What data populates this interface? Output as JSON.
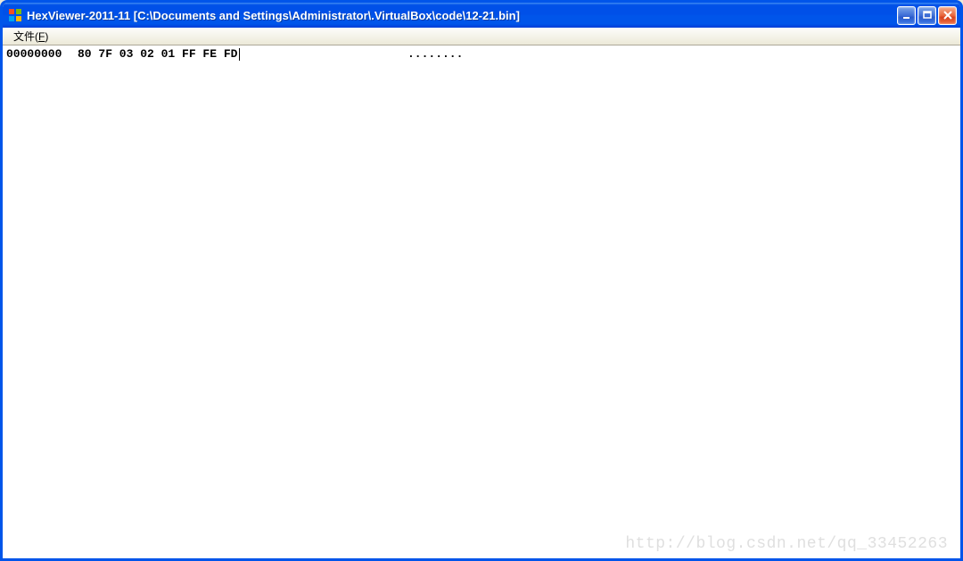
{
  "window": {
    "title": "HexViewer-2011-11 [C:\\Documents and Settings\\Administrator\\.VirtualBox\\code\\12-21.bin]"
  },
  "menubar": {
    "file": {
      "label": "文件",
      "hotkey": "F"
    }
  },
  "content": {
    "rows": [
      {
        "offset": "00000000",
        "bytes": "80 7F 03 02 01 FF FE FD",
        "ascii": "........"
      }
    ]
  },
  "watermark": "http://blog.csdn.net/qq_33452263"
}
